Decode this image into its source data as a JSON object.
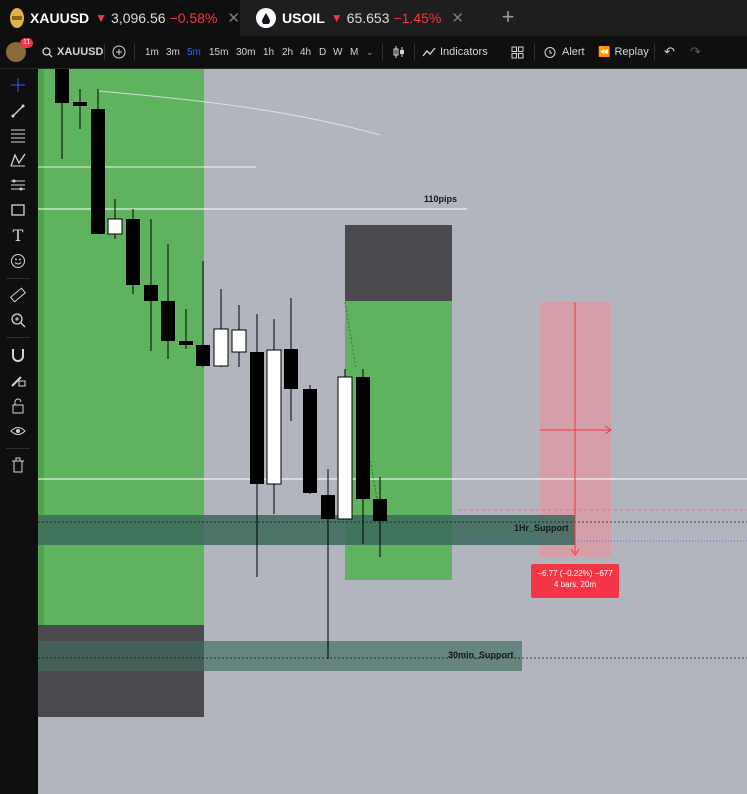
{
  "tabs": [
    {
      "symbol": "XAUUSD",
      "price": "3,096.56",
      "change": "−0.58%",
      "active": true,
      "icon": "gold-coin-icon"
    },
    {
      "symbol": "USOIL",
      "price": "65.653",
      "change": "−1.45%",
      "active": false,
      "icon": "oil-drop-icon"
    }
  ],
  "toolbar": {
    "notification_badge": "11",
    "symbol": "XAUUSD",
    "timeframes": [
      "1m",
      "3m",
      "5m",
      "15m",
      "30m",
      "1h",
      "2h",
      "4h",
      "D",
      "W",
      "M"
    ],
    "selected_timeframe": "5m",
    "indicators_label": "Indicators",
    "alert_label": "Alert",
    "replay_label": "Replay"
  },
  "left_tools": [
    "crosshair-icon",
    "trendline-icon",
    "fib-retracement-icon",
    "pattern-icon",
    "prediction-icon",
    "rectangle-icon",
    "text-icon",
    "emoji-icon",
    "ruler-icon",
    "zoom-icon",
    "magnet-icon",
    "lock-drawing-icon",
    "lock-icon",
    "eye-icon",
    "trash-icon"
  ],
  "chart": {
    "annotations": {
      "pips": "110pips",
      "support_1hr": "1Hr_Support",
      "support_30min": "30min_Support"
    },
    "measure": {
      "line1": "−6.77 (−0.22%) −677",
      "line2": "4 bars, 20m"
    },
    "colors": {
      "background": "#b2b5be",
      "green_zone": "#5fb35f",
      "dark_zone": "#4a4a4e",
      "measure_red": "#f23645",
      "support_teal": "#3d6b5c"
    }
  }
}
